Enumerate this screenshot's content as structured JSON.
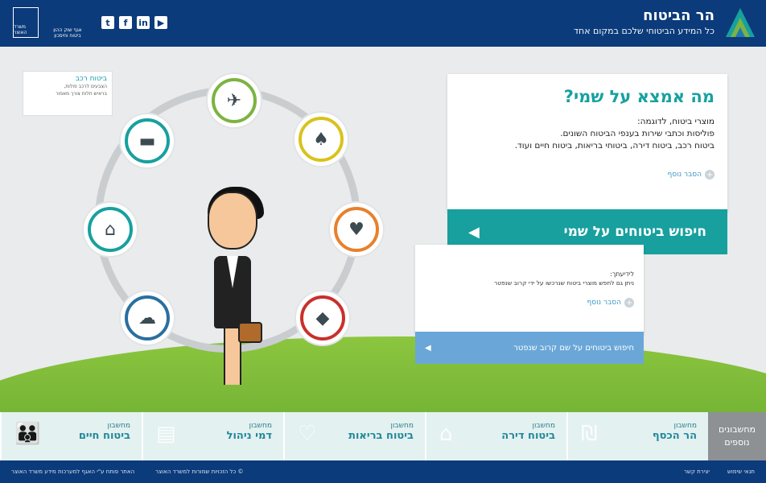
{
  "header": {
    "title": "הר הביטוח",
    "subtitle": "כל המידע הביטוחי שלכם במקום אחד",
    "gov_label": "משרד האוצר",
    "agency_lines": [
      "אגף שוק ההון",
      "ביטוח וחיסכון"
    ],
    "social": [
      "youtube-icon",
      "linkedin-icon",
      "facebook-icon",
      "twitter-icon"
    ]
  },
  "tooltip": {
    "title": "ביטוח רכב",
    "lines": [
      "הצבעים לרכב פולות,",
      "בראיש חלות צורך מאפור"
    ]
  },
  "card": {
    "heading": "מה אמצא על שמי?",
    "lines": [
      "מוצרי ביטוח, לדוגמה:",
      "פוליסות וכתבי שירות בענפי הביטוח השונים.",
      "ביטוח רכב, ביטוח דירה, ביטוחי בריאות, ביטוח חיים ועוד."
    ],
    "more": "הסבר נוסף"
  },
  "search_main": {
    "label": "חיפוש ביטוחים על שמי"
  },
  "card2": {
    "question": "לידיעתך:",
    "desc": "ניתן גם לחפש מוצרי ביטוח שנרכשו על ידי קרוב שנפטר",
    "more": "הסבר נוסף"
  },
  "search_secondary": {
    "label": "חיפוש ביטוחים על שם קרוב שנפטר"
  },
  "ring": {
    "nodes": [
      {
        "name": "flight-icon",
        "glyph": "✈",
        "color": "#7cb342"
      },
      {
        "name": "tooth-icon",
        "glyph": "🦷",
        "color": "#d9c21c"
      },
      {
        "name": "heart-monitor-icon",
        "glyph": "💓",
        "color": "#e8802c"
      },
      {
        "name": "diamond-icon",
        "glyph": "♦",
        "color": "#c9302c"
      },
      {
        "name": "storm-icon",
        "glyph": "⛈",
        "color": "#2a6fa0"
      },
      {
        "name": "house-icon",
        "glyph": "⌂",
        "color": "#17a09e"
      },
      {
        "name": "car-icon",
        "glyph": "🚗",
        "color": "#17a09e"
      }
    ]
  },
  "calculators": {
    "title_lines": [
      "מחשבונים",
      "נוספים"
    ],
    "items": [
      {
        "top": "מחשבון",
        "label": "הר הכסף"
      },
      {
        "top": "מחשבון",
        "label": "ביטוח דירה"
      },
      {
        "top": "מחשבון",
        "label": "ביטוח בריאות"
      },
      {
        "top": "מחשבון",
        "label": "דמי ניהול"
      },
      {
        "top": "מחשבון",
        "label": "ביטוח חיים"
      }
    ]
  },
  "footer": {
    "left_items": [
      "תנאי שימוש",
      "יצירת קשר"
    ],
    "center": "© כל הזכויות שמורות למשרד האוצר",
    "right": "האתר פותח ע\"י האגף למערכות מידע משרד האוצר"
  }
}
